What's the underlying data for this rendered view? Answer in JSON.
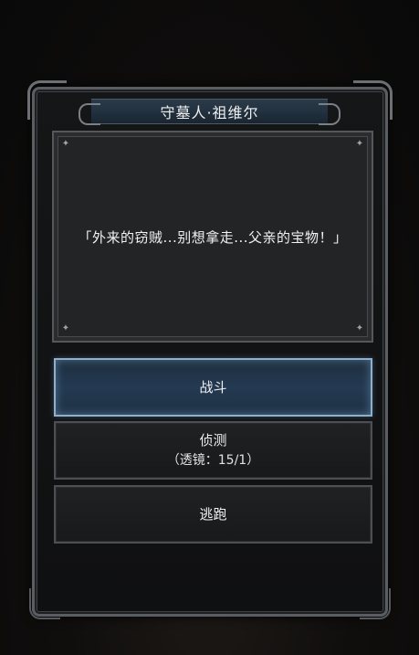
{
  "npc": {
    "name": "守墓人·祖维尔"
  },
  "dialog": {
    "text": "「外来的窃贼...别想拿走...父亲的宝物！」"
  },
  "options": [
    {
      "label": "战斗",
      "selected": true
    },
    {
      "label": "侦测",
      "sub": "（透镜：15/1）",
      "selected": false
    },
    {
      "label": "逃跑",
      "selected": false
    }
  ],
  "colors": {
    "accent_highlight": "#8fb0cc",
    "title_bar": "#223240",
    "frame": "#5a5d61"
  }
}
